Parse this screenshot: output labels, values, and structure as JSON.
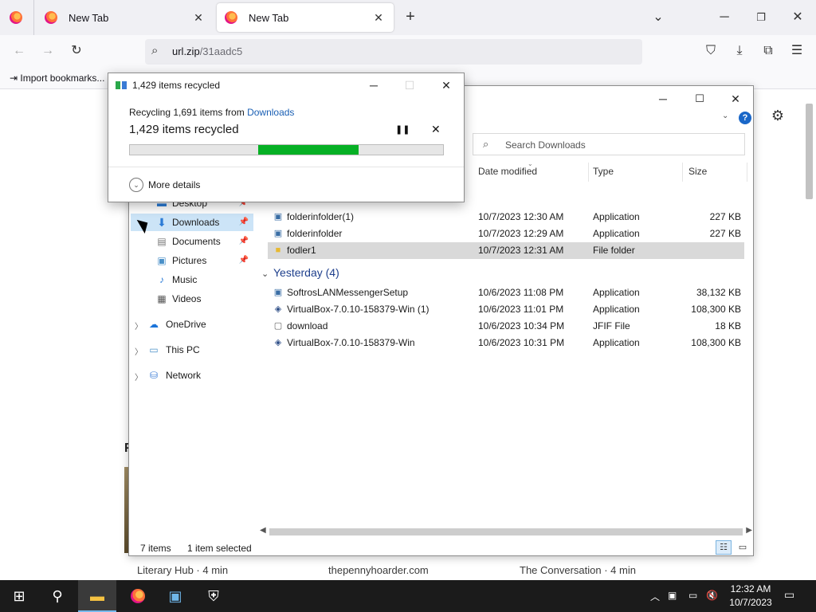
{
  "browser": {
    "tabs": [
      {
        "label": "New Tab"
      },
      {
        "label": "New Tab"
      }
    ],
    "new_tab_label": "+",
    "url_main": "url.zip",
    "url_path": "/31aadc5",
    "bookmarks_import_label": "Import bookmarks...",
    "card_captions": [
      "Literary Hub · 4 min",
      "thepennyhoarder.com",
      "The Conversation · 4 min"
    ],
    "section_letter": "F"
  },
  "explorer": {
    "search_placeholder": "Search Downloads",
    "columns": {
      "date": "Date modified",
      "type": "Type",
      "size": "Size"
    },
    "nav": {
      "desktop": "Desktop",
      "downloads": "Downloads",
      "documents": "Documents",
      "pictures": "Pictures",
      "music": "Music",
      "videos": "Videos",
      "onedrive": "OneDrive",
      "thispc": "This PC",
      "network": "Network"
    },
    "groups": {
      "yesterday": "Yesterday (4)"
    },
    "files_today": [
      {
        "name": "folderinfolder(1)",
        "date": "10/7/2023 12:30 AM",
        "type": "Application",
        "size": "227 KB"
      },
      {
        "name": "folderinfolder",
        "date": "10/7/2023 12:29 AM",
        "type": "Application",
        "size": "227 KB"
      },
      {
        "name": "fodler1",
        "date": "10/7/2023 12:31 AM",
        "type": "File folder",
        "size": ""
      }
    ],
    "files_yesterday": [
      {
        "name": "SoftrosLANMessengerSetup",
        "date": "10/6/2023 11:08 PM",
        "type": "Application",
        "size": "38,132 KB"
      },
      {
        "name": "VirtualBox-7.0.10-158379-Win (1)",
        "date": "10/6/2023 11:01 PM",
        "type": "Application",
        "size": "108,300 KB"
      },
      {
        "name": "download",
        "date": "10/6/2023 10:34 PM",
        "type": "JFIF File",
        "size": "18 KB"
      },
      {
        "name": "VirtualBox-7.0.10-158379-Win",
        "date": "10/6/2023 10:31 PM",
        "type": "Application",
        "size": "108,300 KB"
      }
    ],
    "status": {
      "items": "7 items",
      "selected": "1 item selected"
    }
  },
  "dialog": {
    "title": "1,429 items recycled",
    "from_prefix": "Recycling 1,691 items from ",
    "from_link": "Downloads",
    "status": "1,429 items recycled",
    "progress_start_percent": 41,
    "progress_end_percent": 73,
    "more_details": "More details"
  },
  "taskbar": {
    "time": "12:32 AM",
    "date": "10/7/2023"
  }
}
